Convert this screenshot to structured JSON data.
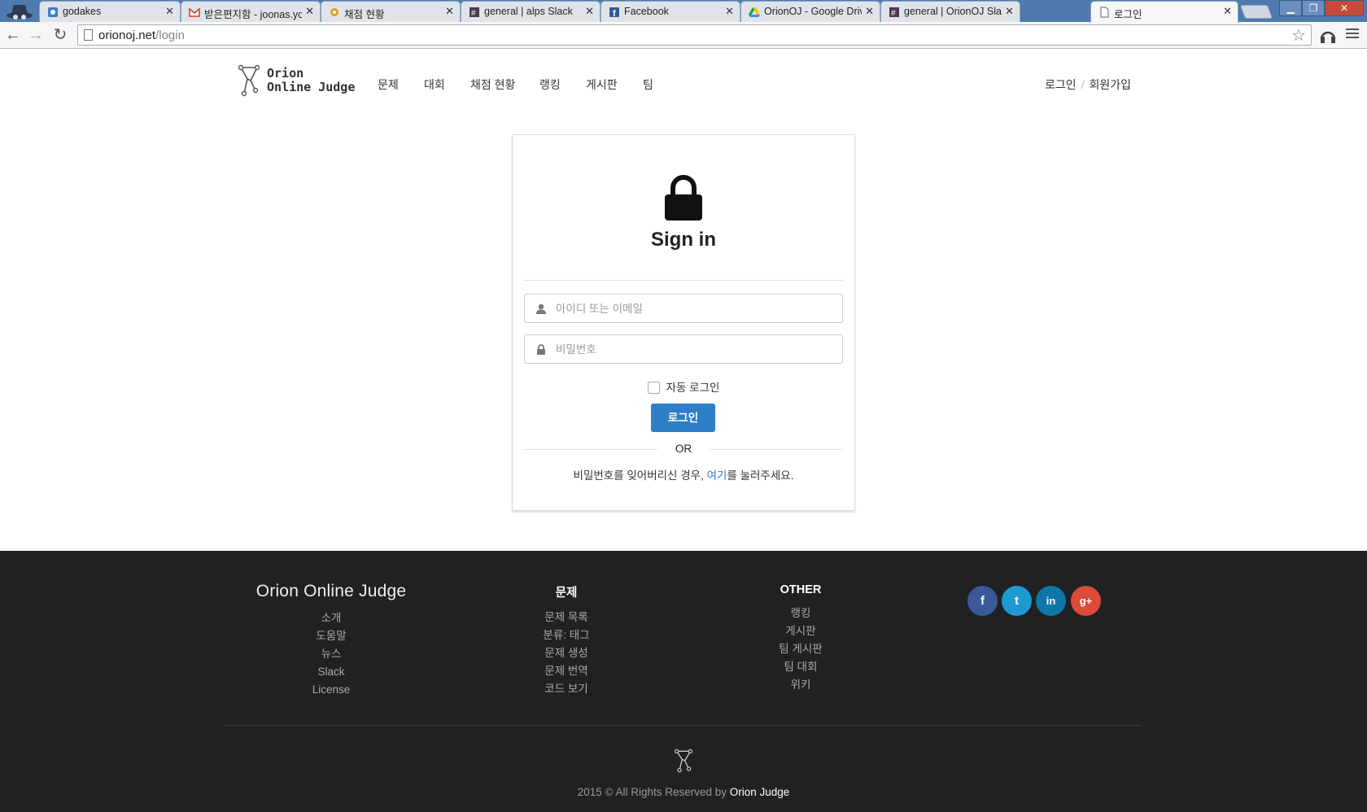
{
  "browser": {
    "tabs": [
      {
        "title": "godakes"
      },
      {
        "title": "받은편지함 - joonas.yoon@gmail.com"
      },
      {
        "title": "채점 현황"
      },
      {
        "title": "general | alps Slack"
      },
      {
        "title": "Facebook"
      },
      {
        "title": "OrionOJ - Google Drive"
      },
      {
        "title": "general | OrionOJ Slack"
      },
      {
        "title": "로그인"
      }
    ],
    "url_host": "orionoj.net",
    "url_path": "/login",
    "colors": {
      "tabstrip": "#4f7ab0",
      "close_button": "#c74b3a"
    }
  },
  "site": {
    "logo_line1": "Orion",
    "logo_line2": "Online Judge",
    "nav": [
      "문제",
      "대회",
      "채점 현황",
      "랭킹",
      "게시판",
      "팀"
    ],
    "login_link": "로그인",
    "signup_link": "회원가입"
  },
  "login": {
    "heading": "Sign in",
    "username_placeholder": "아이디 또는 이메일",
    "password_placeholder": "비밀번호",
    "remember_label": "자동 로그인",
    "submit_label": "로그인",
    "or_label": "OR",
    "forgot_prefix": "비밀번호를 잊어버리신 경우, ",
    "forgot_link": "여기",
    "forgot_suffix": "를 눌러주세요.",
    "accent_color": "#2d7fc7"
  },
  "footer": {
    "brand": "Orion Online Judge",
    "about_links": [
      "소개",
      "도움말",
      "뉴스",
      "Slack",
      "License"
    ],
    "problems_heading": "문제",
    "problems_links": [
      "문제 목록",
      "분류: 태그",
      "문제 생성",
      "문제 번역",
      "코드 보기"
    ],
    "other_heading": "OTHER",
    "other_links": [
      "랭킹",
      "게시판",
      "팀 게시판",
      "팀 대회",
      "위키"
    ],
    "social": [
      {
        "icon": "facebook-icon",
        "glyph": "f",
        "color": "#3b5998"
      },
      {
        "icon": "twitter-icon",
        "glyph": "t",
        "color": "#1d9bd1"
      },
      {
        "icon": "linkedin-icon",
        "glyph": "in",
        "color": "#0e76a8"
      },
      {
        "icon": "google-plus-icon",
        "glyph": "g+",
        "color": "#dd4b39"
      }
    ],
    "copyright_prefix": "2015 © All Rights Reserved by ",
    "copyright_owner": "Orion Judge",
    "background": "#1f2123"
  }
}
